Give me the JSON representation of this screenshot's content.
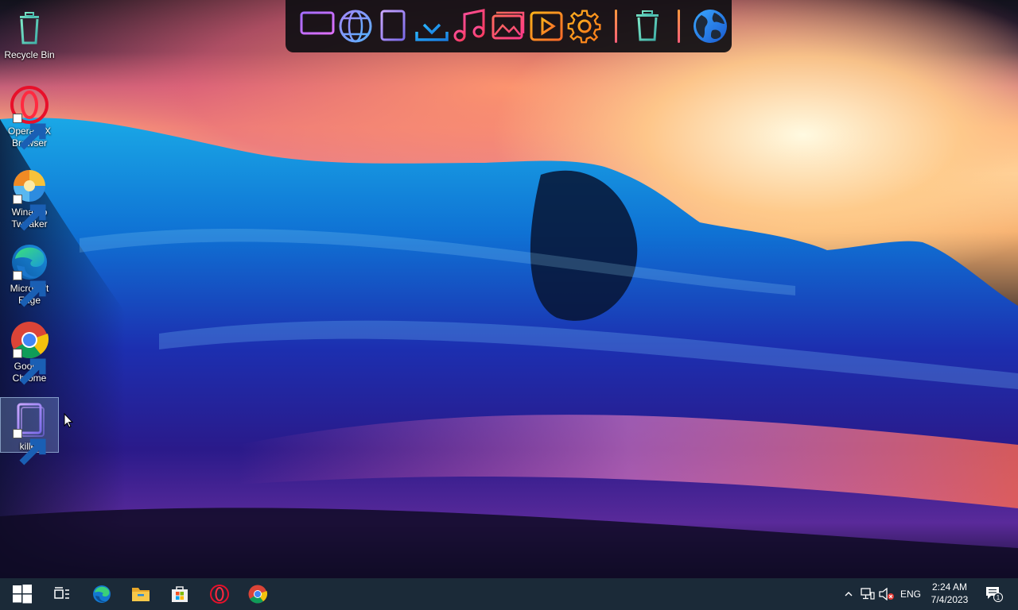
{
  "desktop_icons": [
    {
      "label": "Recycle Bin",
      "icon": "recycle-bin-icon"
    },
    {
      "label": "Opera GX Browser",
      "icon": "opera-gx-icon"
    },
    {
      "label": "Winaero Tweaker",
      "icon": "winaero-tweaker-icon"
    },
    {
      "label": "Microsoft Edge",
      "icon": "edge-icon"
    },
    {
      "label": "Google Chrome",
      "icon": "chrome-icon"
    },
    {
      "label": "killer",
      "icon": "document-lines-icon"
    }
  ],
  "dock": {
    "items": [
      "monitor-icon",
      "globe-icon",
      "document-lines-icon",
      "download-icon",
      "music-icon",
      "pictures-icon",
      "video-play-icon",
      "gear-icon",
      "trash-icon",
      "earth-icon"
    ]
  },
  "taskbar": {
    "start": "windows-start-icon",
    "task_view": "task-view-icon",
    "pinned": [
      "edge-icon",
      "file-explorer-icon",
      "microsoft-store-icon",
      "opera-icon",
      "chrome-icon"
    ],
    "tray": {
      "language": "ENG",
      "time": "2:24 AM",
      "date": "7/4/2023",
      "notification_count": "1"
    }
  },
  "colors": {
    "taskbar": "#1b2a38",
    "dock": "#0e0e12",
    "selection": "#82a0c8"
  }
}
